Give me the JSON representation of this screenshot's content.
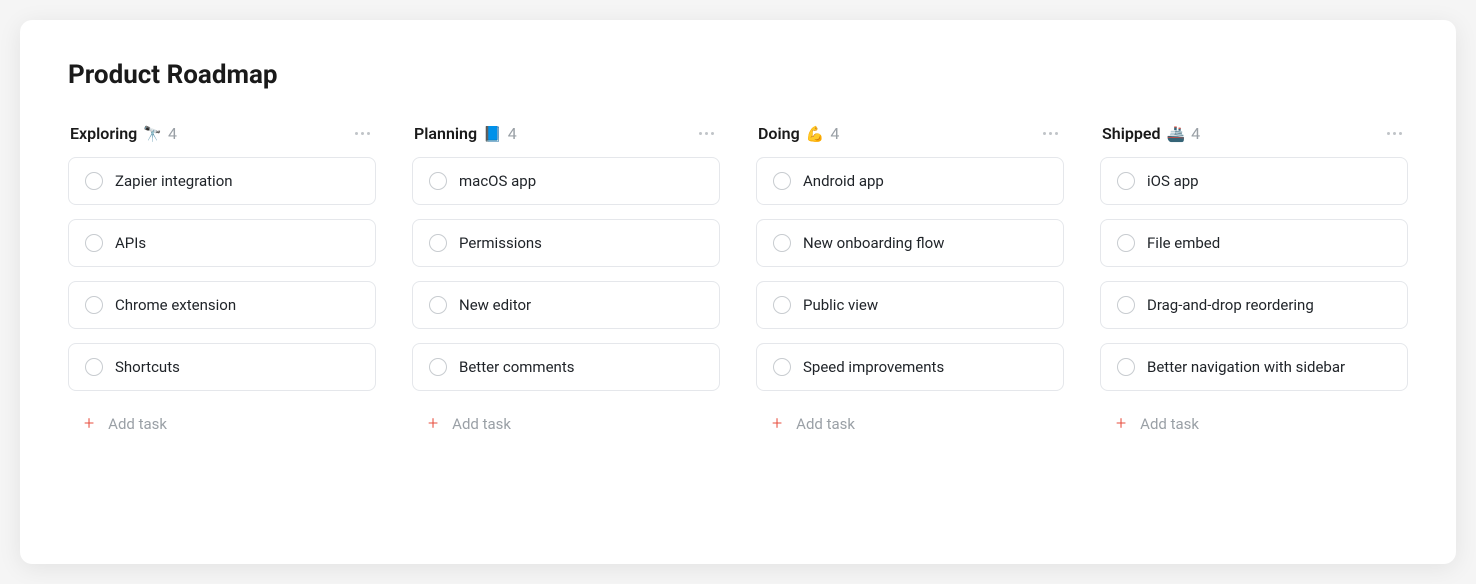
{
  "page_title": "Product Roadmap",
  "add_task_label": "Add task",
  "columns": [
    {
      "title": "Exploring",
      "emoji": "🔭",
      "count": "4",
      "tasks": [
        {
          "title": "Zapier integration"
        },
        {
          "title": "APIs"
        },
        {
          "title": "Chrome extension"
        },
        {
          "title": "Shortcuts"
        }
      ]
    },
    {
      "title": "Planning",
      "emoji": "📘",
      "count": "4",
      "tasks": [
        {
          "title": "macOS app"
        },
        {
          "title": "Permissions"
        },
        {
          "title": "New editor"
        },
        {
          "title": "Better comments"
        }
      ]
    },
    {
      "title": "Doing",
      "emoji": "💪",
      "count": "4",
      "tasks": [
        {
          "title": "Android app"
        },
        {
          "title": "New onboarding flow"
        },
        {
          "title": "Public view"
        },
        {
          "title": "Speed improvements"
        }
      ]
    },
    {
      "title": "Shipped",
      "emoji": "🚢",
      "count": "4",
      "tasks": [
        {
          "title": "iOS app"
        },
        {
          "title": "File embed"
        },
        {
          "title": "Drag-and-drop reordering"
        },
        {
          "title": "Better navigation with sidebar"
        }
      ]
    }
  ]
}
